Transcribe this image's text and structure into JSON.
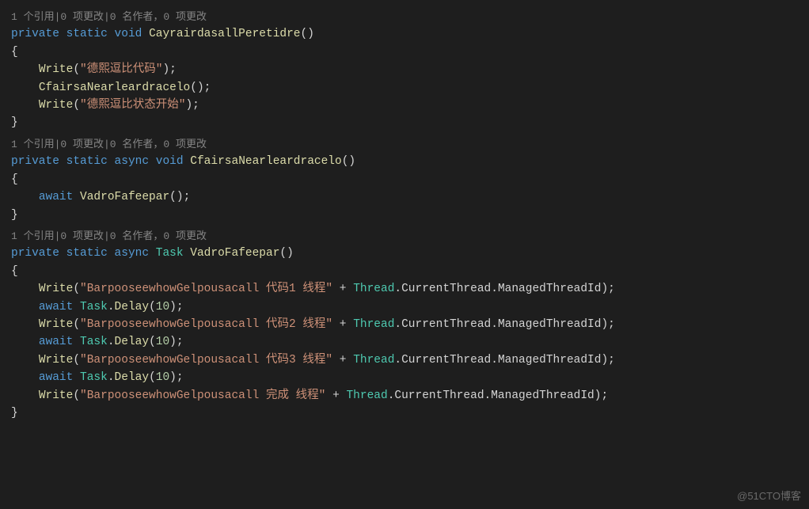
{
  "codelens": "1 个引用|0 项更改|0 名作者，0 项更改",
  "kw_private": "private",
  "kw_static": "static",
  "kw_void": "void",
  "kw_async": "async",
  "kw_await": "await",
  "type_task": "Task",
  "method1": "CayrairdasallPeretidre",
  "method2": "CfairsaNearleardracelo",
  "method3": "VadroFafeepar",
  "fn_write": "Write",
  "fn_delay": "Delay",
  "str1": "\"德熙逗比代码\"",
  "str2": "\"德熙逗比状态开始\"",
  "str_b1": "\"BarpooseewhowGelpousacall 代码1 线程\"",
  "str_b2": "\"BarpooseewhowGelpousacall 代码2 线程\"",
  "str_b3": "\"BarpooseewhowGelpousacall 代码3 线程\"",
  "str_b4": "\"BarpooseewhowGelpousacall 完成 线程\"",
  "class_thread": "Thread",
  "prop_current": "CurrentThread",
  "prop_managed": "ManagedThreadId",
  "class_task": "Task",
  "num_10": "10",
  "plus": " + ",
  "dot": ".",
  "openp": "(",
  "closep": ")",
  "semi": ";",
  "lbrace": "{",
  "rbrace": "}",
  "empty_parens": "()",
  "watermark": "@51CTO博客"
}
